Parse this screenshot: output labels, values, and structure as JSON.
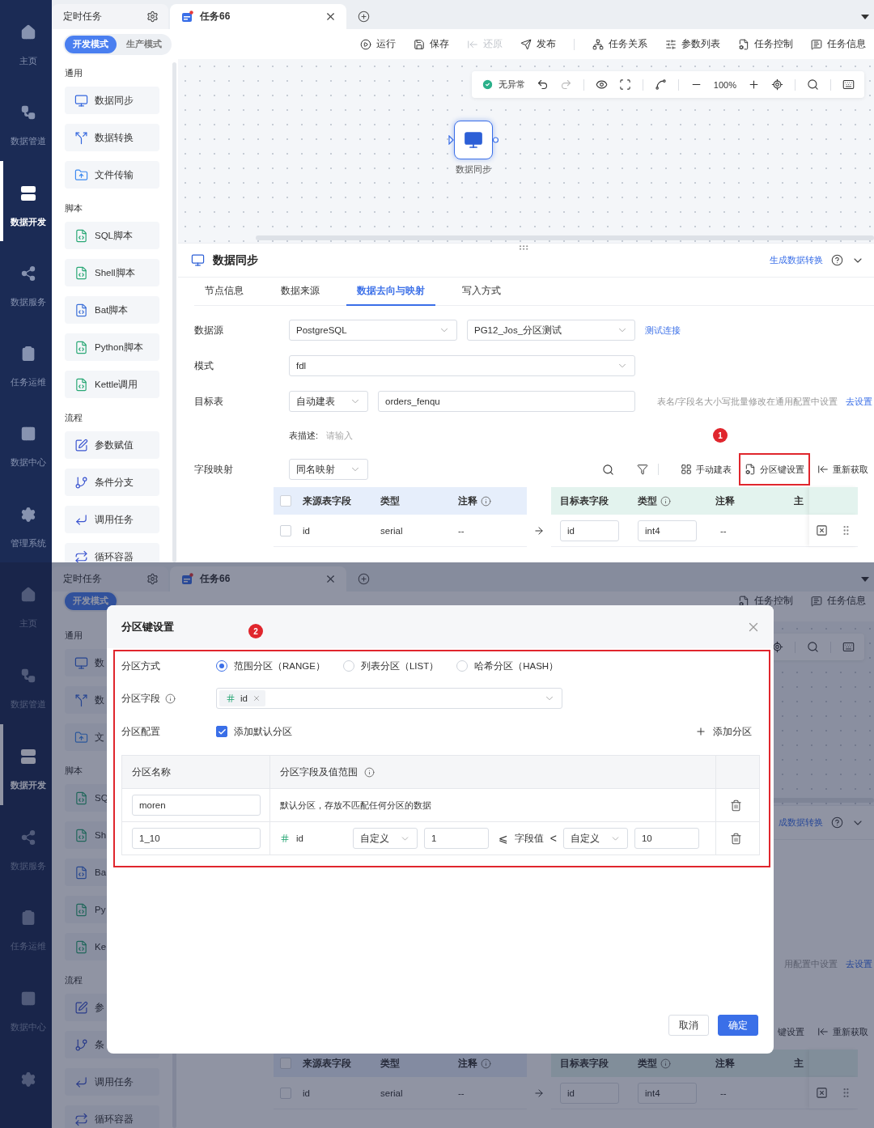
{
  "screen": {
    "nav": [
      {
        "label": "主页",
        "kind": "home",
        "selected": false
      },
      {
        "label": "数据管道",
        "kind": "pipeline",
        "selected": false
      },
      {
        "label": "数据开发",
        "kind": "develop",
        "selected": true
      },
      {
        "label": "数据服务",
        "kind": "service",
        "selected": false
      },
      {
        "label": "任务运维",
        "kind": "ops",
        "selected": false
      },
      {
        "label": "数据中心",
        "kind": "center",
        "selected": false
      },
      {
        "label": "管理系统",
        "kind": "settings",
        "selected": false
      }
    ],
    "tabs": [
      {
        "label": "定时任务",
        "kind": "group",
        "selected": false
      },
      {
        "label": "任务66",
        "kind": "task",
        "selected": true
      }
    ],
    "modes": [
      {
        "label": "开发模式",
        "selected": true
      },
      {
        "label": "生产模式",
        "selected": false
      }
    ],
    "toolbar": {
      "edit": [
        {
          "label": "运行",
          "kind": "run",
          "disabled": false
        },
        {
          "label": "保存",
          "kind": "save",
          "disabled": false
        },
        {
          "label": "还原",
          "kind": "restore",
          "disabled": true
        },
        {
          "label": "发布",
          "kind": "publish",
          "disabled": false
        }
      ],
      "task": [
        {
          "label": "任务关系",
          "kind": "relation",
          "disabled": false
        },
        {
          "label": "参数列表",
          "kind": "params",
          "disabled": false
        },
        {
          "label": "任务控制",
          "kind": "control",
          "disabled": false
        },
        {
          "label": "任务信息",
          "kind": "info",
          "disabled": false
        }
      ]
    },
    "sidebar": [
      {
        "title": "通用",
        "items": [
          {
            "label": "数据同步",
            "kind": "sync"
          },
          {
            "label": "数据转换",
            "kind": "transform"
          },
          {
            "label": "文件传输",
            "kind": "file"
          }
        ]
      },
      {
        "title": "脚本",
        "items": [
          {
            "label": "SQL脚本",
            "kind": "sql"
          },
          {
            "label": "Shell脚本",
            "kind": "shell"
          },
          {
            "label": "Bat脚本",
            "kind": "bat"
          },
          {
            "label": "Python脚本",
            "kind": "python"
          },
          {
            "label": "Kettle调用",
            "kind": "kettle"
          }
        ]
      },
      {
        "title": "流程",
        "items": [
          {
            "label": "参数赋值",
            "kind": "param"
          },
          {
            "label": "条件分支",
            "kind": "branch"
          },
          {
            "label": "调用任务",
            "kind": "call"
          },
          {
            "label": "循环容器",
            "kind": "loop"
          }
        ]
      }
    ],
    "canvas": {
      "toolbar": {
        "status": {
          "label": "无异常",
          "kind": "ok"
        },
        "undo_disabled": false,
        "redo_disabled": true,
        "zoom": "100%"
      },
      "node": {
        "label": "数据同步",
        "selected": true
      }
    },
    "panel": {
      "title": "数据同步",
      "link": "生成数据转换",
      "tabs": [
        {
          "label": "节点信息",
          "selected": false
        },
        {
          "label": "数据来源",
          "selected": false
        },
        {
          "label": "数据去向与映射",
          "selected": true
        },
        {
          "label": "写入方式",
          "selected": false
        }
      ],
      "source": {
        "label": "数据源",
        "type": "PostgreSQL",
        "connection": "PG12_Jos_分区测试",
        "link": "测试连接"
      },
      "schema": {
        "label": "模式",
        "value": "fdl"
      },
      "target": {
        "label": "目标表",
        "mode": "自动建表",
        "table": "orders_fenqu",
        "hint": "表名/字段名大小写批量修改在通用配置中设置",
        "link": "去设置"
      },
      "description": {
        "label": "表描述:",
        "placeholder": "请输入",
        "badge": "1"
      },
      "mapping": {
        "label": "字段映射",
        "mode": "同名映射",
        "search_tools": true,
        "actions": [
          {
            "label": "手动建表",
            "kind": "table",
            "highlighted": false
          },
          {
            "label": "分区键设置",
            "kind": "partition",
            "highlighted": true
          },
          {
            "label": "重新获取",
            "kind": "refresh",
            "highlighted": false
          }
        ]
      },
      "source_table": {
        "header_checked": false,
        "columns": [
          {
            "label": "来源表字段",
            "info": false
          },
          {
            "label": "类型",
            "info": false
          },
          {
            "label": "注释",
            "info": true
          }
        ],
        "rows": [
          {
            "checked": false,
            "field": "id",
            "type": "serial",
            "comment": "--"
          }
        ]
      },
      "target_table": {
        "columns": [
          {
            "label": "目标表字段",
            "info": false
          },
          {
            "label": "类型",
            "info": true
          },
          {
            "label": "注释",
            "info": false
          },
          {
            "label": "主",
            "info": false
          }
        ],
        "rows": [
          {
            "field": "id",
            "type": "int4",
            "comment": "--"
          }
        ]
      }
    }
  },
  "background": {
    "nav": [
      {
        "label": "主页",
        "kind": "home",
        "selected": false
      },
      {
        "label": "数据管道",
        "kind": "pipeline",
        "selected": false
      },
      {
        "label": "数据开发",
        "kind": "develop",
        "selected": true
      },
      {
        "label": "数据服务",
        "kind": "service",
        "selected": false
      },
      {
        "label": "任务运维",
        "kind": "ops",
        "selected": false
      },
      {
        "label": "数据中心",
        "kind": "center",
        "selected": false
      },
      {
        "kind": "settings",
        "selected": false
      }
    ],
    "tabs": [
      {
        "label": "定时任务",
        "kind": "group",
        "selected": false
      },
      {
        "label": "任务66",
        "kind": "task",
        "selected": true
      }
    ],
    "modes": [
      {
        "label": "开发模式",
        "selected": true
      }
    ],
    "toolbar": {
      "task": [
        {
          "label": "任务控制",
          "kind": "control",
          "disabled": false
        },
        {
          "label": "任务信息",
          "kind": "info",
          "disabled": false
        }
      ]
    },
    "sidebar": [
      {
        "title": "通用",
        "items": [
          {
            "label": "数",
            "kind": "sync"
          },
          {
            "label": "数",
            "kind": "transform"
          },
          {
            "label": "文",
            "kind": "file"
          }
        ]
      },
      {
        "title": "脚本",
        "items": [
          {
            "label": "SQ",
            "kind": "sql"
          },
          {
            "label": "Sh",
            "kind": "shell"
          },
          {
            "label": "Ba",
            "kind": "bat"
          },
          {
            "label": "Py",
            "kind": "python"
          },
          {
            "label": "Ke",
            "kind": "kettle"
          }
        ]
      },
      {
        "title": "流程",
        "items": [
          {
            "label": "参",
            "kind": "param"
          },
          {
            "label": "条",
            "kind": "branch"
          },
          {
            "label": "调用任务",
            "kind": "call"
          },
          {
            "label": "循环容器",
            "kind": "loop"
          }
        ]
      }
    ],
    "panel": {
      "link": "成数据转换",
      "target": {
        "hint": "用配置中设置",
        "link": "去设置"
      },
      "mapping": {
        "actions": [
          {
            "label": "键设置",
            "highlighted": false
          },
          {
            "label": "重新获取",
            "kind": "refresh",
            "highlighted": false
          }
        ]
      },
      "source_table": {
        "header_checked": false,
        "columns": [
          {
            "label": "来源表字段",
            "info": false
          },
          {
            "label": "类型",
            "info": false
          },
          {
            "label": "注释",
            "info": true
          }
        ],
        "rows": [
          {
            "checked": false,
            "field": "id",
            "type": "serial",
            "comment": "--"
          }
        ]
      },
      "target_table": {
        "columns": [
          {
            "label": "目标表字段",
            "info": false
          },
          {
            "label": "类型",
            "info": true
          },
          {
            "label": "注释",
            "info": false
          },
          {
            "label": "主",
            "info": false
          }
        ],
        "rows": [
          {
            "field": "id",
            "type": "int4",
            "comment": "--"
          }
        ]
      }
    }
  },
  "dialog": {
    "title": "分区键设置",
    "badge": "2",
    "highlighted": true,
    "method": {
      "label": "分区方式",
      "options": [
        {
          "label": "范围分区（RANGE）",
          "selected": true
        },
        {
          "label": "列表分区（LIST）",
          "selected": false
        },
        {
          "label": "哈希分区（HASH）",
          "selected": false
        }
      ]
    },
    "field": {
      "label": "分区字段",
      "info": true,
      "tags": [
        {
          "label": "id"
        }
      ]
    },
    "config": {
      "label": "分区配置",
      "default_partition": {
        "label": "添加默认分区",
        "checked": true
      },
      "add_button": "添加分区"
    },
    "table": {
      "columns": [
        {
          "label": "分区名称",
          "info": false
        },
        {
          "label": "分区字段及值范围",
          "info": true
        }
      ],
      "rows": [
        {
          "kind": "default",
          "name": "moren",
          "description": "默认分区，存放不匹配任何分区的数据"
        },
        {
          "kind": "range",
          "name": "1_10",
          "field": "id",
          "lower_mode": "自定义",
          "lower_value": "1",
          "lower_op": "⩽",
          "middle": "字段值",
          "upper_op": "<",
          "upper_mode": "自定义",
          "upper_value": "10"
        }
      ]
    },
    "buttons": [
      {
        "label": "取消",
        "kind": "secondary"
      },
      {
        "label": "确定",
        "kind": "primary"
      }
    ]
  }
}
